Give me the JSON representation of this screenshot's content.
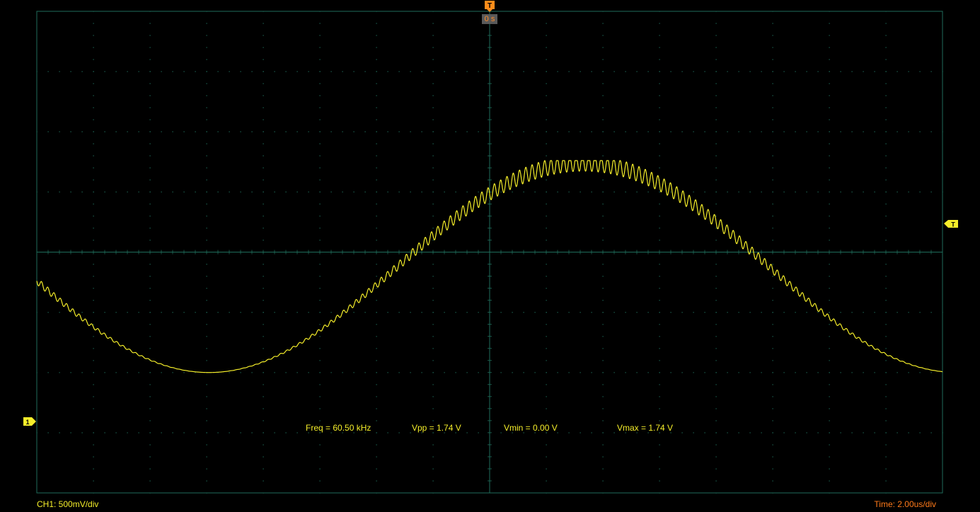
{
  "colors": {
    "trace": "#f5ee2a",
    "grid": "#1f6d5b",
    "trigger": "#ff8c1a",
    "background": "#000000"
  },
  "trigger": {
    "marker": "T",
    "time_offset": "0 s",
    "level_marker": "T"
  },
  "channel": {
    "marker": "1",
    "scale_label": "CH1: 500mV/div"
  },
  "timebase": {
    "label": "Time: 2.00us/div"
  },
  "measurements": {
    "freq": "Freq = 60.50 kHz",
    "vpp": "Vpp = 1.74 V",
    "vmin": "Vmin = 0.00 V",
    "vmax": "Vmax = 1.74 V"
  },
  "icons": {
    "trigger_position": "trigger-position-icon",
    "trigger_level": "trigger-level-icon",
    "channel_ground": "channel-1-ground-icon"
  },
  "chart_data": {
    "type": "line",
    "title": "",
    "xlabel": "",
    "ylabel": "",
    "xlim": [
      -10,
      10
    ],
    "ylim": [
      -1.0,
      3.0
    ],
    "grid": true,
    "series": [
      {
        "frequency_hz": 60500,
        "vmin": 0.0,
        "vmax": 1.74,
        "vpp": 1.74,
        "ripple_pp_v_at_peak": 0.27
      }
    ]
  }
}
